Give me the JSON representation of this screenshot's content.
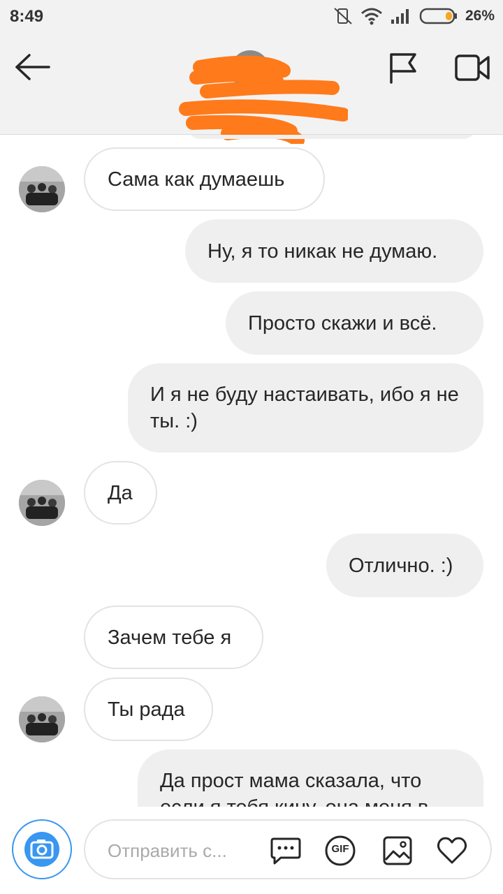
{
  "status_bar": {
    "time": "8:49",
    "battery_percent": "26%",
    "icons": [
      "mute-vibrate-icon",
      "wifi-icon",
      "signal-icon",
      "battery-icon"
    ]
  },
  "header": {
    "icons": [
      "back-arrow-icon",
      "flag-icon",
      "video-call-icon"
    ]
  },
  "messages": [
    {
      "side": "in",
      "text": "Сама как думаешь",
      "avatar": true
    },
    {
      "side": "out",
      "text": "Ну, я то никак не думаю."
    },
    {
      "side": "out",
      "text": "Просто скажи и всё."
    },
    {
      "side": "out",
      "text": "И я не буду настаивать, ибо я не ты. :)"
    },
    {
      "side": "in",
      "text": "Да",
      "avatar": true
    },
    {
      "side": "out",
      "text": "Отлично. :)"
    },
    {
      "side": "in",
      "text": "Зачем тебе я",
      "avatar": false
    },
    {
      "side": "in",
      "text": "Ты рада",
      "avatar": true
    },
    {
      "side": "out",
      "text": "Да прост мама сказала, что если я тебя кину, она меня в"
    }
  ],
  "composer": {
    "placeholder": "Отправить с...",
    "gif_label": "GIF",
    "icons": [
      "camera-icon",
      "chat-bubble-icon",
      "gif-icon",
      "gallery-icon",
      "heart-icon"
    ]
  },
  "colors": {
    "accent": "#3897f0",
    "outgoing_bubble": "#efefef",
    "incoming_border": "#e3e3e3",
    "redaction": "#ff7a1a"
  }
}
